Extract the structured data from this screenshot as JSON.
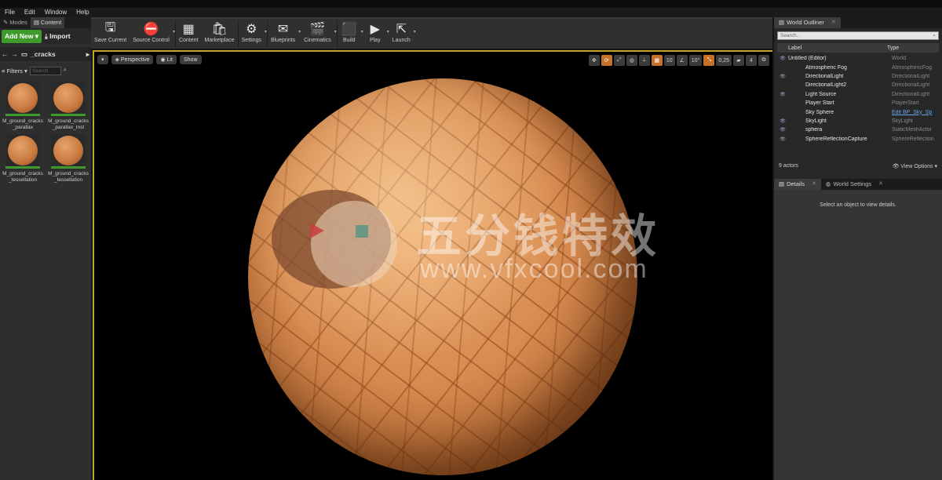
{
  "menu": [
    "File",
    "Edit",
    "Window",
    "Help"
  ],
  "left": {
    "tabs": [
      "Modes",
      "Content"
    ],
    "add_new": "Add New",
    "import": "Import",
    "path": "_cracks",
    "filters": "Filters",
    "search_placeholder": "Search",
    "assets": [
      {
        "name": "M_ground_cracks_parallax"
      },
      {
        "name": "M_ground_cracks_parallax_Inst"
      },
      {
        "name": "M_ground_cracks_tessellation"
      },
      {
        "name": "M_ground_cracks_tessellation"
      }
    ]
  },
  "toolbar": [
    {
      "label": "Save Current",
      "icon": "save-icon"
    },
    {
      "label": "Source Control",
      "icon": "source-control-icon"
    },
    {
      "label": "Content",
      "icon": "content-icon"
    },
    {
      "label": "Marketplace",
      "icon": "marketplace-icon"
    },
    {
      "label": "Settings",
      "icon": "settings-icon"
    },
    {
      "label": "Blueprints",
      "icon": "blueprints-icon"
    },
    {
      "label": "Cinematics",
      "icon": "cinematics-icon"
    },
    {
      "label": "Build",
      "icon": "build-icon"
    },
    {
      "label": "Play",
      "icon": "play-icon"
    },
    {
      "label": "Launch",
      "icon": "launch-icon"
    }
  ],
  "viewport": {
    "perspective": "Perspective",
    "lit": "Lit",
    "show": "Show",
    "grid_snap": "10",
    "rot_snap": "10°",
    "scale_snap": "0,25",
    "camera_speed": "4",
    "watermark_text": "五分钱特效",
    "watermark_url": "www.vfxcool.com",
    "accent_color": "#c7a229"
  },
  "outliner": {
    "tab": "World Outliner",
    "search_placeholder": "Search...",
    "col_label": "Label",
    "col_type": "Type",
    "rows": [
      {
        "label": "Untitled (Editor)",
        "type": "World"
      },
      {
        "label": "Atmospheric Fog",
        "type": "AtmosphericFog"
      },
      {
        "label": "DirectionalLight",
        "type": "DirectionalLight"
      },
      {
        "label": "DirectionalLight2",
        "type": "DirectionalLight"
      },
      {
        "label": "Light Source",
        "type": "DirectionalLight"
      },
      {
        "label": "Player Start",
        "type": "PlayerStart"
      },
      {
        "label": "Sky Sphere",
        "type": "Edit BP_Sky_Sp"
      },
      {
        "label": "SkyLight",
        "type": "SkyLight"
      },
      {
        "label": "sphera",
        "type": "StaticMeshActor"
      },
      {
        "label": "SphereReflectionCapture",
        "type": "SphereReflection"
      }
    ],
    "count": "9 actors",
    "view_options": "View Options"
  },
  "details": {
    "tab": "Details",
    "tab2": "World Settings",
    "message": "Select an object to view details."
  }
}
